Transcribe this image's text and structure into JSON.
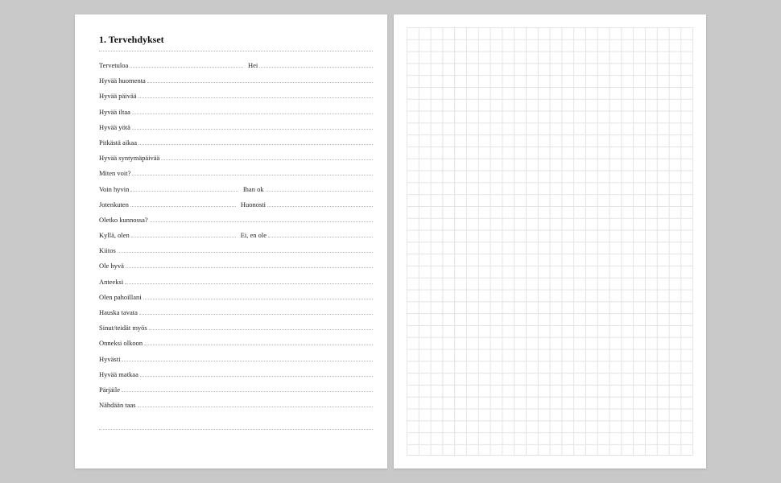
{
  "left": {
    "heading": "1. Tervehdykset",
    "rows": [
      {
        "a": "Tervetuloa",
        "b": "Hei"
      },
      {
        "a": "Hyvää huomenta"
      },
      {
        "a": "Hyvää päivää"
      },
      {
        "a": "Hyvää iltaa"
      },
      {
        "a": "Hyvää yötä"
      },
      {
        "a": "Pitkästä aikaa"
      },
      {
        "a": "Hyvää syntymäpäivää"
      },
      {
        "a": "Miten voit?"
      },
      {
        "a": "Voin hyvin",
        "b": "Ihan ok"
      },
      {
        "a": "Jotenkuten",
        "b": "Huonosti"
      },
      {
        "a": "Oletko kunnossa?"
      },
      {
        "a": "Kyllä, olen",
        "b": "Ei, en ole"
      },
      {
        "a": "Kiitos"
      },
      {
        "a": "Ole hyvä"
      },
      {
        "a": "Anteeksi"
      },
      {
        "a": "Olen pahoillani"
      },
      {
        "a": "Hauska tavata"
      },
      {
        "a": "Sinut/teidät myös"
      },
      {
        "a": "Onneksi olkoon"
      },
      {
        "a": "Hyvästi"
      },
      {
        "a": "Hyvää matkaa"
      },
      {
        "a": "Pärjäile"
      },
      {
        "a": "Nähdään taas"
      }
    ]
  }
}
